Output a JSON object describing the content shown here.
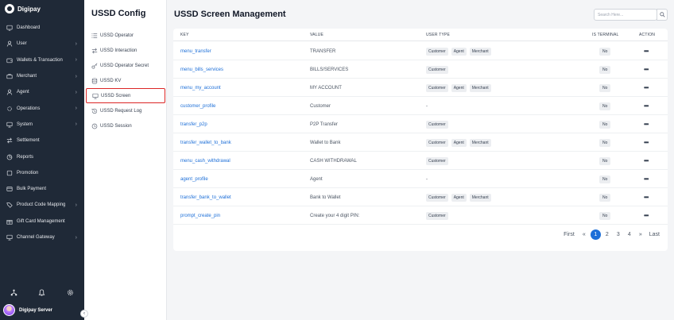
{
  "brand": {
    "name": "Digipay"
  },
  "sidebar": {
    "items": [
      {
        "label": "Dashboard",
        "icon": "dashboard-icon",
        "chevron": false
      },
      {
        "label": "User",
        "icon": "user-icon",
        "chevron": true
      },
      {
        "label": "Wallets & Transaction",
        "icon": "wallet-icon",
        "chevron": true
      },
      {
        "label": "Merchant",
        "icon": "merchant-icon",
        "chevron": true
      },
      {
        "label": "Agent",
        "icon": "agent-icon",
        "chevron": true
      },
      {
        "label": "Operations",
        "icon": "operations-icon",
        "chevron": true
      },
      {
        "label": "System",
        "icon": "system-icon",
        "chevron": true
      },
      {
        "label": "Settlement",
        "icon": "settlement-icon",
        "chevron": false
      },
      {
        "label": "Reports",
        "icon": "reports-icon",
        "chevron": false
      },
      {
        "label": "Promotion",
        "icon": "promotion-icon",
        "chevron": false
      },
      {
        "label": "Bulk Payment",
        "icon": "bulk-payment-icon",
        "chevron": false
      },
      {
        "label": "Product Code Mapping",
        "icon": "product-code-icon",
        "chevron": true
      },
      {
        "label": "Gift Card Management",
        "icon": "gift-card-icon",
        "chevron": false
      },
      {
        "label": "Channel Gateway",
        "icon": "channel-gateway-icon",
        "chevron": true
      }
    ],
    "user_name": "Digipay Server"
  },
  "subpanel": {
    "title": "USSD Config",
    "items": [
      {
        "label": "USSD Operator",
        "icon": "list-icon"
      },
      {
        "label": "USSD Interaction",
        "icon": "swap-icon"
      },
      {
        "label": "USSD Operator Secret",
        "icon": "key-icon"
      },
      {
        "label": "USSD KV",
        "icon": "database-icon"
      },
      {
        "label": "USSD Screen",
        "icon": "monitor-icon",
        "active": true
      },
      {
        "label": "USSD Request Log",
        "icon": "history-icon"
      },
      {
        "label": "USSD Session",
        "icon": "clock-icon"
      }
    ]
  },
  "main": {
    "title": "USSD Screen Management",
    "search_placeholder": "Search Here...",
    "columns": {
      "key": "KEY",
      "value": "VALUE",
      "user_type": "USER TYPE",
      "is_terminal": "IS TERMINAL",
      "action": "ACTION"
    },
    "rows": [
      {
        "key": "menu_transfer",
        "value": "TRANSFER",
        "user_types": [
          "Customer",
          "Agent",
          "Merchant"
        ],
        "is_terminal": "No"
      },
      {
        "key": "menu_bills_services",
        "value": "BILLS/SERVICES",
        "user_types": [
          "Customer"
        ],
        "is_terminal": "No"
      },
      {
        "key": "menu_my_account",
        "value": "MY ACCOUNT",
        "user_types": [
          "Customer",
          "Agent",
          "Merchant"
        ],
        "is_terminal": "No"
      },
      {
        "key": "customer_profile",
        "value": "Customer",
        "user_types": [],
        "empty_type": "-",
        "is_terminal": "No"
      },
      {
        "key": "transfer_p2p",
        "value": "P2P Transfer",
        "user_types": [
          "Customer"
        ],
        "is_terminal": "No"
      },
      {
        "key": "transfer_wallet_to_bank",
        "value": "Wallet to Bank",
        "user_types": [
          "Customer",
          "Agent",
          "Merchant"
        ],
        "is_terminal": "No"
      },
      {
        "key": "menu_cash_withdrawal",
        "value": "CASH WITHDRAWAL",
        "user_types": [
          "Customer"
        ],
        "is_terminal": "No"
      },
      {
        "key": "agent_profile",
        "value": "Agent",
        "user_types": [],
        "empty_type": "-",
        "is_terminal": "No"
      },
      {
        "key": "transfer_bank_to_wallet",
        "value": "Bank to Wallet",
        "user_types": [
          "Customer",
          "Agent",
          "Merchant"
        ],
        "is_terminal": "No"
      },
      {
        "key": "prompt_create_pin",
        "value": "Create your 4 digit PIN:",
        "user_types": [
          "Customer"
        ],
        "is_terminal": "No"
      }
    ],
    "action_glyph": "•••"
  },
  "pagination": {
    "first": "First",
    "prev": "«",
    "pages": [
      "1",
      "2",
      "3",
      "4"
    ],
    "active": "1",
    "next": "»",
    "last": "Last"
  },
  "colors": {
    "sidebar_bg": "#1f2937",
    "link": "#1d6fd8",
    "active_border": "#dc2626"
  }
}
